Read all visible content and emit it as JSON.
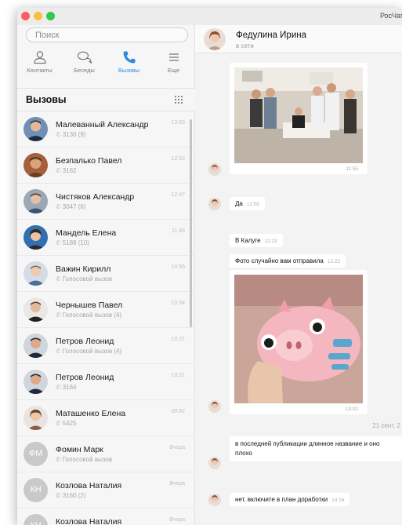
{
  "window": {
    "app_title": "РосЧат"
  },
  "sidebar": {
    "search_placeholder": "Поиск",
    "tabs": [
      {
        "label": "Контакты",
        "icon": "person-icon"
      },
      {
        "label": "Беседы",
        "icon": "chat-bubbles-icon"
      },
      {
        "label": "Вызовы",
        "icon": "phone-icon",
        "active": true
      },
      {
        "label": "Еще",
        "icon": "menu-icon"
      }
    ],
    "section_title": "Вызовы",
    "calls": [
      {
        "name": "Малеванный Александр",
        "sub": "3130 (9)",
        "time": "13:53"
      },
      {
        "name": "Безпалько Павел",
        "sub": "3162",
        "time": "12:52"
      },
      {
        "name": "Чистяков Александр",
        "sub": "3047 (6)",
        "time": "12:47"
      },
      {
        "name": "Мандель Елена",
        "sub": "5188 (10)",
        "time": "11:46"
      },
      {
        "name": "Важин Кирилл",
        "sub": "Голосовой вызов",
        "time": "10:56"
      },
      {
        "name": "Чернышев Павел",
        "sub": "Голосовой вызов (4)",
        "time": "10:54"
      },
      {
        "name": "Петров Леонид",
        "sub": "Голосовой вызов (4)",
        "time": "10:21"
      },
      {
        "name": "Петров Леонид",
        "sub": "3164",
        "time": "10:21"
      },
      {
        "name": "Маташенко Елена",
        "sub": "5425",
        "time": "09:42"
      },
      {
        "name": "Фомин Марк",
        "sub": "Голосовой вызов",
        "time": "Вчера",
        "initials": "ФМ"
      },
      {
        "name": "Козлова Наталия",
        "sub": "3160 (2)",
        "time": "Вчера",
        "initials": "КН"
      },
      {
        "name": "Козлова Наталия",
        "sub": "",
        "time": "Вчера",
        "initials": "КН"
      }
    ]
  },
  "chat": {
    "contact_name": "Федулина Ирина",
    "status": "в сети",
    "messages": {
      "img1_time": "11:55",
      "m1_text": "Да",
      "m1_time": "12:00",
      "m2_text": "В Калуге",
      "m2_time": "12:23",
      "m3_text": "Фото случайно вам отправила",
      "m3_time": "12:23",
      "img2_time": "13:02",
      "date_sep": "21 сент. 2",
      "m4_line1": "в последней публикации длинное название и оно",
      "m4_line2": "плохо",
      "m5_text": "нет, включите в план доработки",
      "m5_time": "14:16"
    }
  },
  "colors": {
    "accent": "#2d8ae0"
  }
}
